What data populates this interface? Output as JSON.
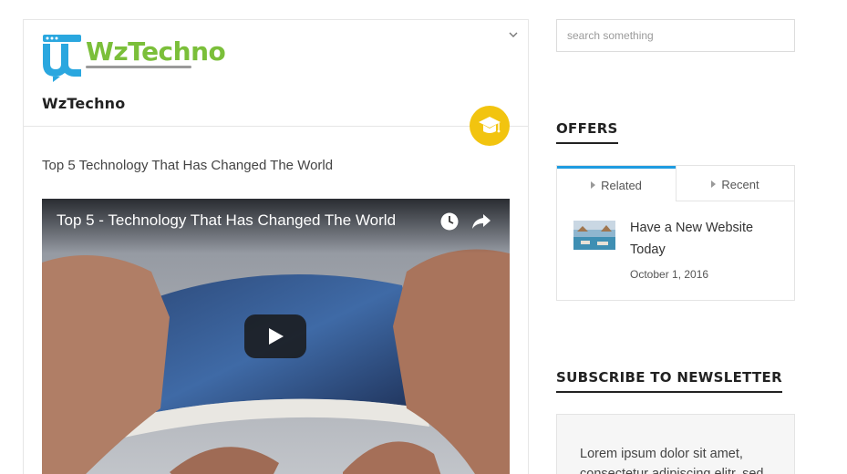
{
  "post": {
    "site_name": "WzTechno",
    "logo_text": "WzTechno",
    "title": "Top 5 Technology That Has Changed The World",
    "video_title": "Top 5 - Technology That Has Changed The World"
  },
  "sidebar": {
    "search_placeholder": "search something",
    "offers_heading": "OFFERS",
    "tabs": [
      {
        "label": "Related"
      },
      {
        "label": "Recent"
      }
    ],
    "related_item": {
      "title": "Have a New Website Today",
      "date": "October 1, 2016"
    },
    "newsletter_heading": "SUBSCRIBE TO NEWSLETTER",
    "newsletter_text": "Lorem ipsum dolor sit amet, consectetur adipiscing elitr, sed"
  },
  "colors": {
    "accent_blue": "#1e9be0",
    "badge_yellow": "#f2c40f",
    "logo_green": "#7bbf3a",
    "logo_blue": "#2aa7df"
  },
  "icons": [
    "chevron-down-icon",
    "graduation-cap-icon",
    "clock-icon",
    "share-icon",
    "play-icon",
    "caret-right-icon"
  ]
}
